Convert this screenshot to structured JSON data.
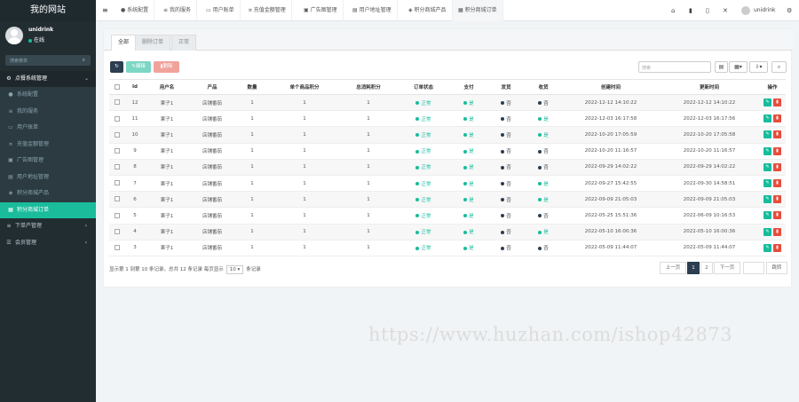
{
  "sidebar": {
    "brand": "我的网站",
    "user_name": "unidrink",
    "user_status": "在线",
    "search_placeholder": "搜索菜单",
    "group_label": "点餐系统管理",
    "items": [
      {
        "label": "系统配置"
      },
      {
        "label": "我的服务"
      },
      {
        "label": "用户账单"
      },
      {
        "label": "充值金额管理"
      },
      {
        "label": "广告图管理"
      },
      {
        "label": "用户地址管理"
      },
      {
        "label": "积分商城产品"
      },
      {
        "label": "积分商城订单"
      }
    ],
    "bottom_items": [
      {
        "label": "下单产管理"
      },
      {
        "label": "会员管理"
      }
    ],
    "colors": {
      "bg": "#222d32",
      "active": "#1abc9c"
    }
  },
  "topbar": {
    "menu_icon": "hamburger-icon",
    "tabs": [
      {
        "label": "系统配置"
      },
      {
        "label": "我的服务"
      },
      {
        "label": "用户账单"
      },
      {
        "label": "充值金额管理"
      },
      {
        "label": "广告图管理"
      },
      {
        "label": "用户地址管理"
      },
      {
        "label": "积分商城产品"
      },
      {
        "label": "积分商城订单"
      }
    ],
    "user_name": "unidrink"
  },
  "panel": {
    "tabs": [
      {
        "label": "全部"
      },
      {
        "label": "删除订单"
      },
      {
        "label": "正常"
      }
    ],
    "toolbar": {
      "edit_label": "编辑",
      "delete_label": "删除",
      "search_placeholder": "搜索"
    },
    "columns": [
      "",
      "Id",
      "用户名",
      "产品",
      "数量",
      "单个商品积分",
      "总消耗积分",
      "订单状态",
      "支付",
      "发货",
      "收货",
      "创建时间",
      "更新时间",
      "操作"
    ],
    "rows": [
      {
        "id": "12",
        "user": "果子1",
        "product": "店铺番茄",
        "qty": "1",
        "unit": "1",
        "total": "1",
        "status": "正常",
        "pay": "是",
        "ship": "否",
        "recv": "否",
        "created": "2022-12-12 14:10:22",
        "updated": "2022-12-12 14:10:22"
      },
      {
        "id": "11",
        "user": "果子1",
        "product": "店铺番茄",
        "qty": "1",
        "unit": "1",
        "total": "1",
        "status": "正常",
        "pay": "是",
        "ship": "否",
        "recv": "是",
        "created": "2022-12-03 16:17:58",
        "updated": "2022-12-03 16:17:56"
      },
      {
        "id": "10",
        "user": "果子1",
        "product": "店铺番茄",
        "qty": "1",
        "unit": "1",
        "total": "1",
        "status": "正常",
        "pay": "是",
        "ship": "否",
        "recv": "是",
        "created": "2022-10-20 17:05:59",
        "updated": "2022-10-20 17:05:58"
      },
      {
        "id": "9",
        "user": "果子1",
        "product": "店铺番茄",
        "qty": "1",
        "unit": "1",
        "total": "1",
        "status": "正常",
        "pay": "是",
        "ship": "否",
        "recv": "否",
        "created": "2022-10-20 11:16:57",
        "updated": "2022-10-20 11:16:57"
      },
      {
        "id": "8",
        "user": "果子1",
        "product": "店铺番茄",
        "qty": "1",
        "unit": "1",
        "total": "1",
        "status": "正常",
        "pay": "是",
        "ship": "否",
        "recv": "否",
        "created": "2022-09-29 14:02:22",
        "updated": "2022-09-29 14:02:22"
      },
      {
        "id": "7",
        "user": "果子1",
        "product": "店铺番茄",
        "qty": "1",
        "unit": "1",
        "total": "1",
        "status": "正常",
        "pay": "是",
        "ship": "否",
        "recv": "是",
        "created": "2022-09-27 15:42:55",
        "updated": "2022-09-30 14:58:51"
      },
      {
        "id": "6",
        "user": "果子1",
        "product": "店铺番茄",
        "qty": "1",
        "unit": "1",
        "total": "1",
        "status": "正常",
        "pay": "是",
        "ship": "否",
        "recv": "是",
        "created": "2022-09-09 21:05:03",
        "updated": "2022-09-09 21:05:03"
      },
      {
        "id": "5",
        "user": "果子1",
        "product": "店铺番茄",
        "qty": "1",
        "unit": "1",
        "total": "1",
        "status": "正常",
        "pay": "是",
        "ship": "否",
        "recv": "否",
        "created": "2022-05-25 15:51:36",
        "updated": "2022-06-09 10:16:53"
      },
      {
        "id": "4",
        "user": "果子1",
        "product": "店铺番茄",
        "qty": "1",
        "unit": "1",
        "total": "1",
        "status": "正常",
        "pay": "是",
        "ship": "否",
        "recv": "是",
        "created": "2022-05-10 16:00:36",
        "updated": "2022-05-10 16:00:36"
      },
      {
        "id": "3",
        "user": "果子1",
        "product": "店铺番茄",
        "qty": "1",
        "unit": "1",
        "total": "1",
        "status": "正常",
        "pay": "是",
        "ship": "否",
        "recv": "否",
        "created": "2022-05-09 11:44:07",
        "updated": "2022-05-09 11:44:07"
      }
    ],
    "footer": {
      "info_prefix": "显示第 1 到第 10 条记录，总共 12 条记录 每页显示",
      "page_size": "10",
      "info_suffix": "条记录"
    },
    "pager": {
      "prev": "上一页",
      "pages": [
        "1",
        "2"
      ],
      "next": "下一页",
      "jump": "跳转"
    }
  },
  "watermark": "https://www.huzhan.com/ishop42873",
  "colors": {
    "green": "#18bc9c",
    "dark": "#2c3e50",
    "red": "#e74c3c",
    "edit": "#18bc9c"
  }
}
